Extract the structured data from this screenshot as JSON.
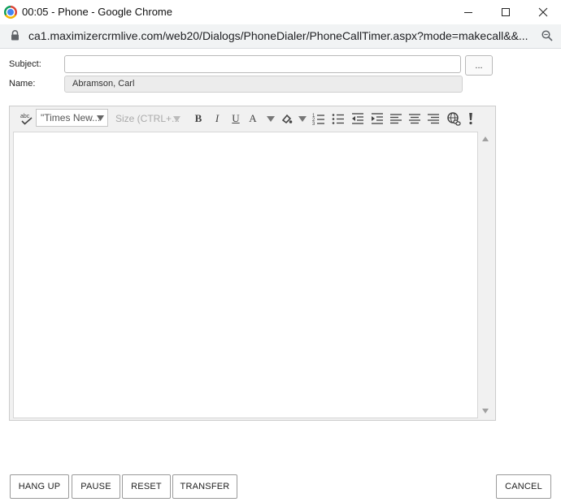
{
  "window": {
    "title": "00:05 - Phone - Google Chrome",
    "url": "ca1.maximizercrmlive.com/web20/Dialogs/PhoneDialer/PhoneCallTimer.aspx?mode=makecall&&..."
  },
  "form": {
    "subject_label": "Subject:",
    "subject_value": "",
    "lookup_label": "...",
    "name_label": "Name:",
    "name_value": "Abramson, Carl"
  },
  "editor": {
    "font_name": "\"Times New...",
    "font_size_placeholder": "Size (CTRL+...",
    "bold": "B",
    "italic": "I",
    "underline": "U",
    "font_color": "A",
    "content": ""
  },
  "buttons": {
    "hang_up": "HANG UP",
    "pause": "PAUSE",
    "reset": "RESET",
    "transfer": "TRANSFER",
    "cancel": "CANCEL"
  },
  "icons": [
    "chrome-logo-icon",
    "minimize-icon",
    "maximize-icon",
    "close-icon",
    "lock-icon",
    "zoom-icon",
    "spellcheck-icon",
    "highlight-icon",
    "numbered-list-icon",
    "bullet-list-icon",
    "outdent-icon",
    "indent-icon",
    "align-left-icon",
    "align-center-icon",
    "align-right-icon",
    "link-icon",
    "important-icon"
  ]
}
